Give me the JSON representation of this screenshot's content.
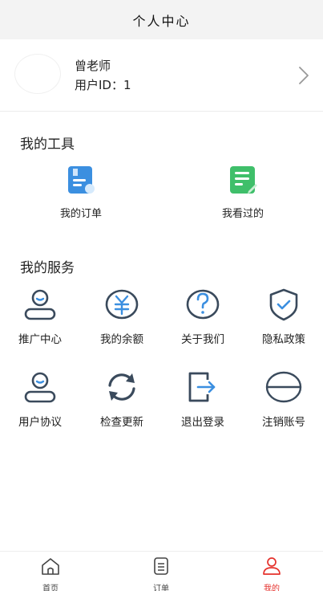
{
  "header": {
    "title": "个人中心"
  },
  "profile": {
    "name": "曾老师",
    "id_text": "用户ID：1"
  },
  "tools": {
    "title": "我的工具",
    "items": [
      {
        "label": "我的订单",
        "icon": "order-icon"
      },
      {
        "label": "我看过的",
        "icon": "viewed-icon"
      }
    ]
  },
  "services": {
    "title": "我的服务",
    "items": [
      {
        "label": "推广中心",
        "icon": "user-icon"
      },
      {
        "label": "我的余额",
        "icon": "yuan-icon"
      },
      {
        "label": "关于我们",
        "icon": "question-icon"
      },
      {
        "label": "隐私政策",
        "icon": "shield-check-icon"
      },
      {
        "label": "用户协议",
        "icon": "user-icon"
      },
      {
        "label": "检查更新",
        "icon": "refresh-icon"
      },
      {
        "label": "退出登录",
        "icon": "logout-icon"
      },
      {
        "label": "注销账号",
        "icon": "cancel-icon"
      }
    ]
  },
  "tabbar": {
    "items": [
      {
        "label": "首页",
        "icon": "home-icon"
      },
      {
        "label": "订单",
        "icon": "list-icon"
      },
      {
        "label": "我的",
        "icon": "person-icon",
        "active": true
      }
    ]
  },
  "colors": {
    "accent": "#e5322d",
    "icon_dark": "#3a4a5c",
    "icon_blue": "#3b8fe0",
    "icon_green": "#3fbf6a"
  }
}
